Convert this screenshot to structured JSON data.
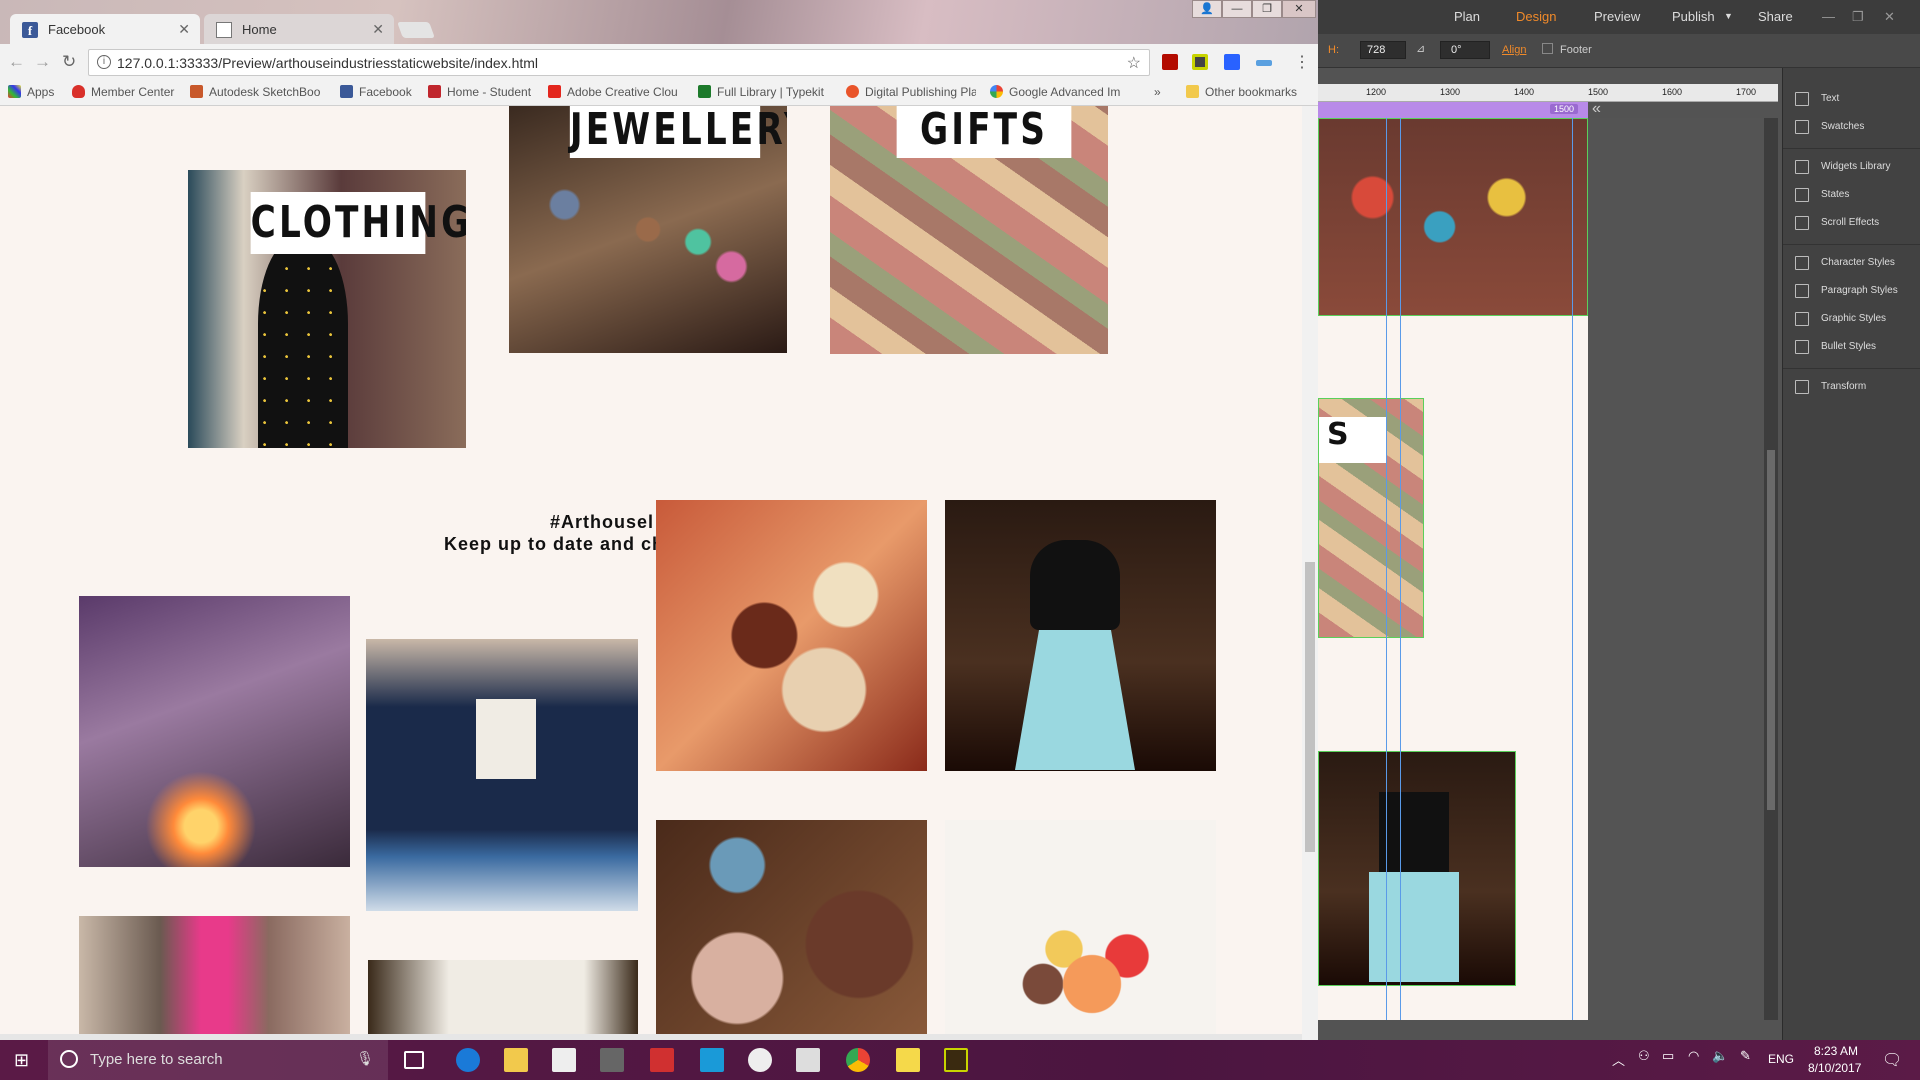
{
  "browser": {
    "tabs": [
      {
        "title": "Facebook",
        "close": "✕"
      },
      {
        "title": "Home",
        "close": "✕"
      }
    ],
    "url": "127.0.0.1:33333/Preview/arthouseindustriesstaticwebsite/index.html",
    "bookmarks": [
      "Apps",
      "Member Center",
      "Autodesk SketchBoo",
      "Facebook",
      "Home - Student",
      "Adobe Creative Clou",
      "Full Library | Typekit",
      "Digital Publishing Pla",
      "Google Advanced Im"
    ],
    "bookmarks_overflow": "»",
    "other_bookmarks": "Other bookmarks",
    "window_buttons": [
      "👤",
      "—",
      "❐",
      "✕"
    ]
  },
  "page": {
    "categories": [
      {
        "label": "CLOTHING"
      },
      {
        "label": "JEWELLERY"
      },
      {
        "label": "GIFTS"
      }
    ],
    "hashtag_line1": "#Arthousel",
    "hashtag_line2": "Keep up to date and ch",
    "muse_partial_label": "S"
  },
  "muse": {
    "nav": [
      "Plan",
      "Design",
      "Preview",
      "Publish",
      "Share"
    ],
    "active_nav": "Design",
    "controls": {
      "h_label": "H:",
      "h_value": "728",
      "angle_value": "0°",
      "align": "Align",
      "footer": "Footer"
    },
    "ruler_ticks": [
      "1200",
      "1300",
      "1400",
      "1500",
      "1600",
      "1700"
    ],
    "breakpoint": "1500",
    "panels": [
      "Text",
      "Swatches",
      "Widgets Library",
      "States",
      "Scroll Effects",
      "Character Styles",
      "Paragraph Styles",
      "Graphic Styles",
      "Bullet Styles",
      "Transform"
    ]
  },
  "taskbar": {
    "search_placeholder": "Type here to search",
    "language": "ENG",
    "time": "8:23 AM",
    "date": "8/10/2017"
  }
}
